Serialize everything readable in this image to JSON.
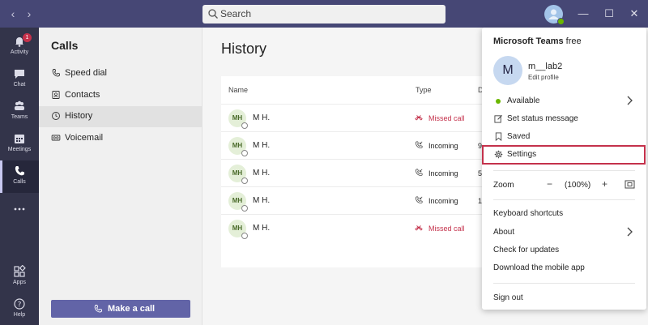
{
  "titlebar": {
    "search_placeholder": "Search"
  },
  "rail": {
    "activity_label": "Activity",
    "activity_badge": "1",
    "chat_label": "Chat",
    "teams_label": "Teams",
    "meetings_label": "Meetings",
    "calls_label": "Calls",
    "apps_label": "Apps",
    "help_label": "Help"
  },
  "calls_panel": {
    "title": "Calls",
    "items": [
      {
        "label": "Speed dial",
        "icon": "phone-icon"
      },
      {
        "label": "Contacts",
        "icon": "contacts-icon"
      },
      {
        "label": "History",
        "icon": "clock-icon"
      },
      {
        "label": "Voicemail",
        "icon": "voicemail-icon"
      }
    ],
    "make_call_label": "Make a call"
  },
  "main": {
    "title": "History",
    "columns": {
      "name": "Name",
      "type": "Type",
      "duration": "D"
    },
    "rows": [
      {
        "initials": "MH",
        "name": "M H.",
        "type": "Missed call",
        "missed": true,
        "duration": ""
      },
      {
        "initials": "MH",
        "name": "M H.",
        "type": "Incoming",
        "missed": false,
        "duration": "9"
      },
      {
        "initials": "MH",
        "name": "M H.",
        "type": "Incoming",
        "missed": false,
        "duration": "5"
      },
      {
        "initials": "MH",
        "name": "M H.",
        "type": "Incoming",
        "missed": false,
        "duration": "1"
      },
      {
        "initials": "MH",
        "name": "M H.",
        "type": "Missed call",
        "missed": true,
        "duration": ""
      }
    ]
  },
  "profile_menu": {
    "product_name": "Microsoft Teams",
    "product_tier": "free",
    "avatar_initial": "M",
    "user_name": "m__lab2",
    "edit_profile": "Edit profile",
    "available": "Available",
    "set_status": "Set status message",
    "saved": "Saved",
    "settings": "Settings",
    "zoom_label": "Zoom",
    "zoom_minus": "−",
    "zoom_value": "(100%)",
    "zoom_plus": "+",
    "keyboard_shortcuts": "Keyboard shortcuts",
    "about": "About",
    "check_updates": "Check for updates",
    "download_app": "Download the mobile app",
    "sign_out": "Sign out"
  },
  "colors": {
    "titlebar": "#464775",
    "rail": "#33344a",
    "brand": "#6264a7",
    "missed": "#c4314b",
    "available": "#6bb700"
  }
}
